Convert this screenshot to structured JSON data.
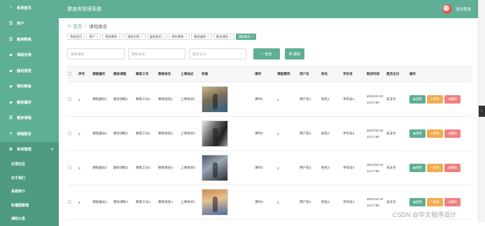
{
  "sidebar": {
    "items": [
      {
        "icon": "home-icon",
        "glyph": "⌂",
        "label": "系统首页"
      },
      {
        "icon": "list-icon",
        "glyph": "☰",
        "label": "用户"
      },
      {
        "icon": "list-icon",
        "glyph": "☰",
        "label": "健身教练"
      },
      {
        "icon": "chat-icon",
        "glyph": "▰",
        "label": "课程名称"
      },
      {
        "icon": "chat-icon",
        "glyph": "▰",
        "label": "器材类型"
      },
      {
        "icon": "chat-icon",
        "glyph": "▰",
        "label": "预约教练"
      },
      {
        "icon": "chat-icon",
        "glyph": "▰",
        "label": "健身器材"
      },
      {
        "icon": "list-icon",
        "glyph": "☰",
        "label": "健身课程"
      },
      {
        "icon": "user-icon",
        "glyph": "●",
        "label": "课程报名"
      },
      {
        "icon": "gear-icon",
        "glyph": "⚙",
        "label": "系统管理",
        "arrow": "▾"
      }
    ],
    "sub_items": [
      "反馈社区",
      "关于我们",
      "系统简介",
      "轮播图管理",
      "通知公告"
    ]
  },
  "header": {
    "title": "健身房管理系统",
    "logout": "退出登录"
  },
  "breadcrumb": {
    "home": "首页",
    "separator": "/",
    "current": "课程报名"
  },
  "tags": [
    {
      "label": "系统首页",
      "closable": false,
      "active": false
    },
    {
      "label": "用户",
      "closable": true,
      "active": false
    },
    {
      "label": "健身教练",
      "closable": true,
      "active": false
    },
    {
      "label": "课程名称",
      "closable": true,
      "active": false
    },
    {
      "label": "器材类型",
      "closable": true,
      "active": false
    },
    {
      "label": "预约教练",
      "closable": true,
      "active": false
    },
    {
      "label": "健身器材",
      "closable": true,
      "active": false
    },
    {
      "label": "健身课程",
      "closable": true,
      "active": false
    },
    {
      "label": "课程报名",
      "closable": true,
      "active": true
    }
  ],
  "search": {
    "course_placeholder": "健身课程",
    "coach_placeholder": "教练姓名",
    "pay_placeholder": "是否支付",
    "search_label": "查询",
    "delete_label": "删除"
  },
  "table": {
    "headers": [
      "序号",
      "课程编号",
      "健身课程",
      "教练工号",
      "教练姓名",
      "上课地点",
      "封面",
      "课时",
      "课程费用",
      "用户名",
      "姓名",
      "手机号",
      "购买时间",
      "是否支付",
      "操作"
    ],
    "rows": [
      {
        "no": "1",
        "code": "课程编号1",
        "course": "健身课程1",
        "coach_id": "教练工号1",
        "coach_name": "教练姓名1",
        "place": "上课地点1",
        "hours": "课时1",
        "fee": "1",
        "username": "用户名1",
        "name": "姓名1",
        "phone": "手机号1",
        "date": "2024-03-24",
        "time": "14:17:50",
        "paid": "未支付"
      },
      {
        "no": "2",
        "code": "课程编号2",
        "course": "健身课程2",
        "coach_id": "教练工号2",
        "coach_name": "教练姓名2",
        "place": "上课地点2",
        "hours": "课时2",
        "fee": "2",
        "username": "用户名2",
        "name": "姓名2",
        "phone": "手机号2",
        "date": "2024-03-24",
        "time": "14:17:50",
        "paid": "未支付"
      },
      {
        "no": "3",
        "code": "课程编号3",
        "course": "健身课程3",
        "coach_id": "教练工号3",
        "coach_name": "教练姓名3",
        "place": "上课地点3",
        "hours": "课时3",
        "fee": "3",
        "username": "用户名3",
        "name": "姓名3",
        "phone": "手机号3",
        "date": "2024-03-24",
        "time": "14:17:50",
        "paid": "未支付"
      },
      {
        "no": "4",
        "code": "课程编号4",
        "course": "健身课程4",
        "coach_id": "教练工号4",
        "coach_name": "教练姓名4",
        "place": "上课地点4",
        "hours": "课时4",
        "fee": "4",
        "username": "用户名4",
        "name": "姓名4",
        "phone": "手机号4",
        "date": "2024-03-24",
        "time": "14:17:50",
        "paid": "未支付"
      }
    ],
    "actions": {
      "view": "查看",
      "edit": "修改",
      "delete": "删除"
    }
  },
  "watermark": "CSDN @毕文程序设计",
  "colors": {
    "primary": "#5fae96",
    "edit": "#f0ad4e",
    "delete": "#f08080"
  }
}
